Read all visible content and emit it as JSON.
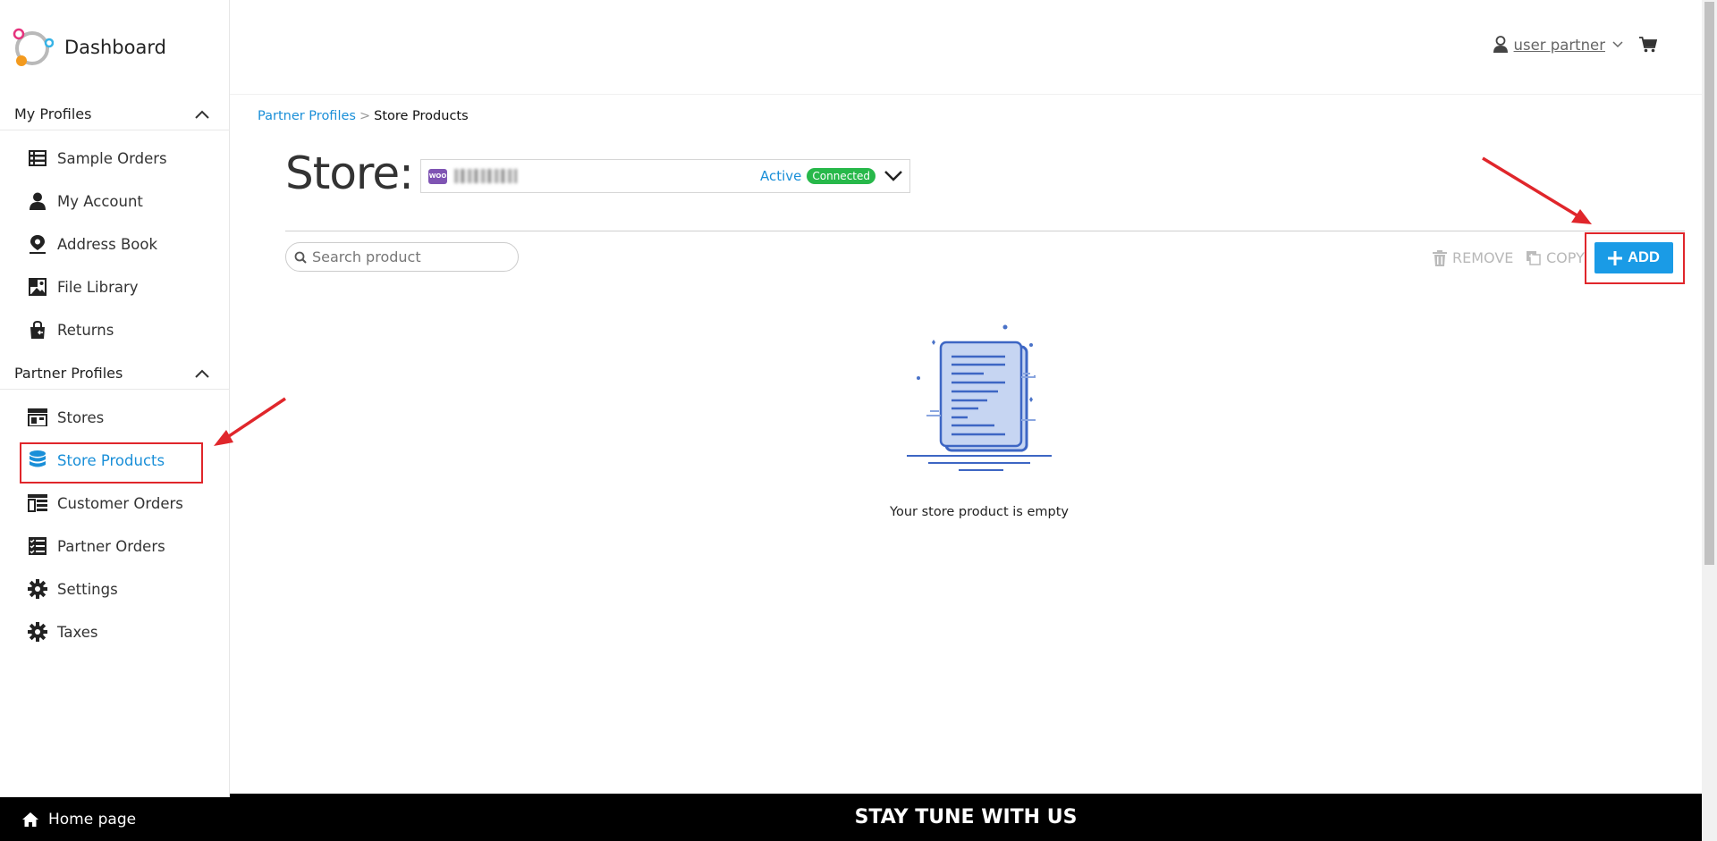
{
  "sidebar": {
    "logo_text": "Dashboard",
    "my_profiles": {
      "title": "My Profiles",
      "items": [
        {
          "label": "Sample Orders",
          "icon": "list-icon"
        },
        {
          "label": "My Account",
          "icon": "user-icon"
        },
        {
          "label": "Address Book",
          "icon": "map-pin-icon"
        },
        {
          "label": "File Library",
          "icon": "image-icon"
        },
        {
          "label": "Returns",
          "icon": "bag-return-icon"
        }
      ]
    },
    "partner_profiles": {
      "title": "Partner Profiles",
      "items": [
        {
          "label": "Stores",
          "icon": "store-icon"
        },
        {
          "label": "Store Products",
          "icon": "database-icon",
          "active": true
        },
        {
          "label": "Customer Orders",
          "icon": "order-list-icon"
        },
        {
          "label": "Partner Orders",
          "icon": "checklist-icon"
        },
        {
          "label": "Settings",
          "icon": "gear-icon"
        },
        {
          "label": "Taxes",
          "icon": "gear-icon"
        }
      ]
    },
    "home_link": "Home page"
  },
  "header": {
    "username": "user partner"
  },
  "breadcrumb": {
    "parent": "Partner Profiles",
    "separator": ">",
    "current": "Store Products"
  },
  "store": {
    "label": "Store:",
    "platform_badge": "WOO",
    "status": "Active",
    "connection": "Connected"
  },
  "toolbar": {
    "search_placeholder": "Search product",
    "remove_label": "REMOVE",
    "copy_label": "COPY",
    "add_label": "ADD"
  },
  "empty_state": {
    "message": "Your store product is empty"
  },
  "footer": {
    "text": "STAY TUNE WITH US"
  },
  "colors": {
    "accent": "#1a8fd8",
    "add_button": "#1a9be6",
    "connected": "#27b84a",
    "annotation": "#e0262b",
    "woo": "#7f54b3"
  }
}
